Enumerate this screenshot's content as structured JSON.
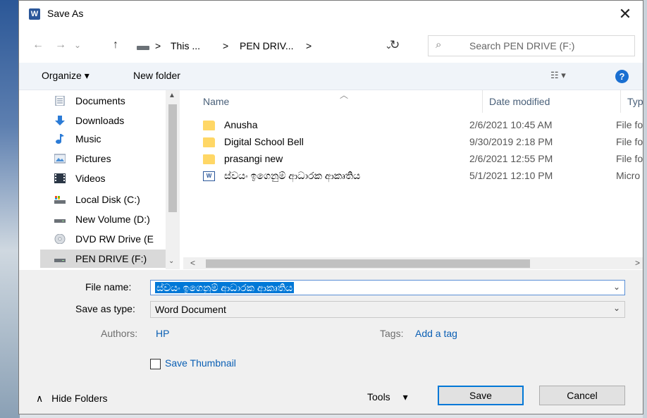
{
  "window": {
    "title": "Save As",
    "app_icon_text": "W",
    "close_symbol": "✕"
  },
  "nav": {
    "back_symbol": "←",
    "forward_symbol": "→",
    "dropdown_symbol": "⌄",
    "up_symbol": "↑",
    "breadcrumbs": [
      "This ...",
      "PEN DRIV..."
    ],
    "crumb_separator": ">",
    "refresh_symbol": "↻",
    "search_placeholder": "Search PEN DRIVE (F:)",
    "search_icon": "⌕"
  },
  "toolbar": {
    "organize_label": "Organize ▾",
    "new_folder_label": "New folder",
    "view_symbol": "☷ ▾",
    "help_symbol": "?"
  },
  "sidebar": {
    "items": [
      {
        "label": "Documents",
        "icon": "documents-icon"
      },
      {
        "label": "Downloads",
        "icon": "downloads-icon"
      },
      {
        "label": "Music",
        "icon": "music-icon"
      },
      {
        "label": "Pictures",
        "icon": "pictures-icon"
      },
      {
        "label": "Videos",
        "icon": "videos-icon"
      },
      {
        "label": "Local Disk (C:)",
        "icon": "local-disk-icon"
      },
      {
        "label": "New Volume (D:)",
        "icon": "drive-icon"
      },
      {
        "label": "DVD RW Drive (E",
        "icon": "dvd-icon"
      },
      {
        "label": "PEN DRIVE (F:)",
        "icon": "usb-drive-icon",
        "selected": true
      }
    ],
    "expand_symbol": "⌄"
  },
  "file_list": {
    "columns": [
      "Name",
      "Date modified",
      "Type"
    ],
    "rows": [
      {
        "name": "Anusha",
        "date": "2/6/2021 10:45 AM",
        "type": "File fo",
        "kind": "folder"
      },
      {
        "name": "Digital School Bell",
        "date": "9/30/2019 2:18 PM",
        "type": "File fo",
        "kind": "folder"
      },
      {
        "name": "prasangi new",
        "date": "2/6/2021 12:55 PM",
        "type": "File fo",
        "kind": "folder"
      },
      {
        "name": "ස්වයං ඉගෙනුම් ආධාරක ආකෘතිය",
        "date": "5/1/2021 12:10 PM",
        "type": "Micro",
        "kind": "word-doc"
      }
    ]
  },
  "form": {
    "file_name_label": "File name:",
    "file_name_value": "ස්වයං ඉගෙනුම් ආධාරක ආකෘතිය",
    "save_as_type_label": "Save as type:",
    "save_as_type_value": "Word Document",
    "authors_label": "Authors:",
    "authors_value": "HP",
    "tags_label": "Tags:",
    "tags_value": "Add a tag",
    "save_thumbnail_label": "Save Thumbnail",
    "save_thumbnail_checked": false,
    "dropdown_symbol": "⌄"
  },
  "footer": {
    "hide_folders_label": "Hide Folders",
    "hide_folders_symbol": "∧",
    "tools_label": "Tools",
    "tools_symbol": "▾",
    "save_label": "Save",
    "cancel_label": "Cancel"
  },
  "colors": {
    "accent": "#0078d7",
    "link": "#0a5fb4",
    "folder": "#ffd766",
    "word": "#2b579a"
  }
}
